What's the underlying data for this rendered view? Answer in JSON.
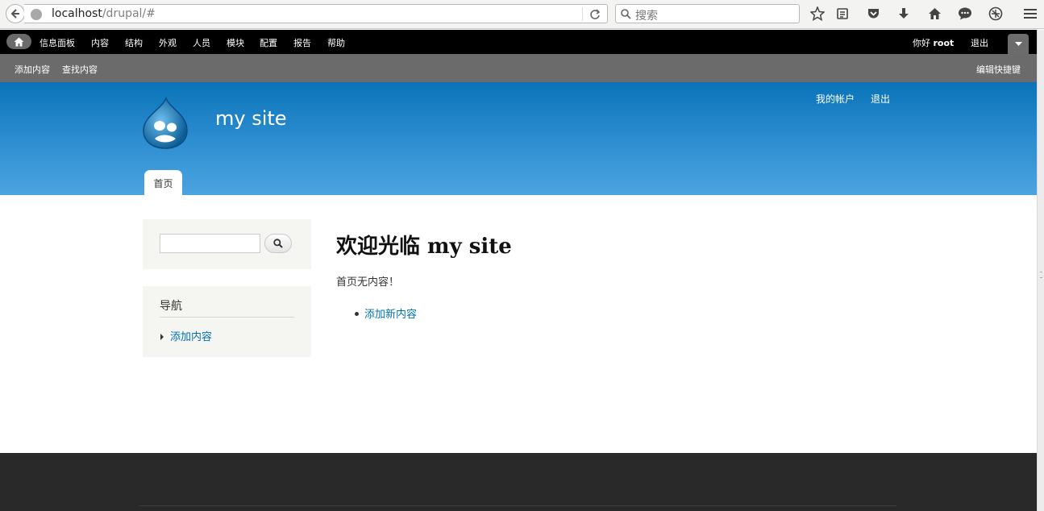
{
  "browser": {
    "url_host": "localhost",
    "url_path": "/drupal/#",
    "search_placeholder": "搜索"
  },
  "toolbar": {
    "menu": [
      "信息面板",
      "内容",
      "结构",
      "外观",
      "人员",
      "模块",
      "配置",
      "报告",
      "帮助"
    ],
    "hello": "你好 ",
    "username": "root",
    "logout": "退出"
  },
  "shortcuts": {
    "items": [
      "添加内容",
      "查找内容"
    ],
    "edit": "编辑快捷键"
  },
  "header": {
    "site_name": "my site",
    "secondary_menu": [
      "我的帐户",
      "退出"
    ],
    "main_tab": "首页"
  },
  "sidebar": {
    "nav_title": "导航",
    "nav_items": [
      "添加内容"
    ]
  },
  "main": {
    "title": "欢迎光临 my site",
    "empty_message": "首页无内容！",
    "links": [
      "添加新内容"
    ]
  },
  "colors": {
    "toolbar": "#000000",
    "shortcut_bar": "#6b6b6b",
    "header_top": "#0a73b8",
    "header_bottom": "#4ca4df",
    "link": "#0071b3",
    "footer": "#292929"
  }
}
